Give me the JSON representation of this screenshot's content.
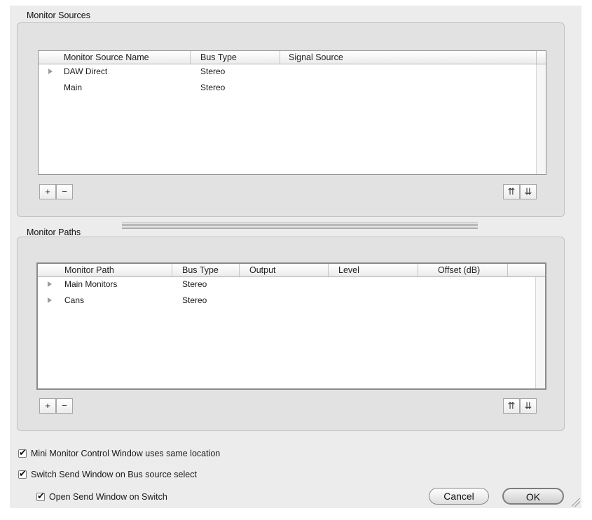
{
  "monitor_sources": {
    "title": "Monitor Sources",
    "columns": [
      "Monitor Source Name",
      "Bus Type",
      "Signal Source"
    ],
    "rows": [
      {
        "name": "DAW Direct",
        "bus_type": "Stereo",
        "signal_source": "",
        "expandable": true
      },
      {
        "name": "Main",
        "bus_type": "Stereo",
        "signal_source": "",
        "expandable": false
      }
    ],
    "buttons": {
      "add": "+",
      "remove": "−",
      "move_up": "⇈",
      "move_down": "⇊"
    }
  },
  "monitor_paths": {
    "title": "Monitor Paths",
    "columns": [
      "Monitor Path",
      "Bus Type",
      "Output",
      "Level",
      "Offset (dB)"
    ],
    "rows": [
      {
        "name": "Main Monitors",
        "bus_type": "Stereo",
        "output": "",
        "level": "",
        "offset": "",
        "expandable": true
      },
      {
        "name": "Cans",
        "bus_type": "Stereo",
        "output": "",
        "level": "",
        "offset": "",
        "expandable": true
      }
    ],
    "buttons": {
      "add": "+",
      "remove": "−",
      "move_up": "⇈",
      "move_down": "⇊"
    }
  },
  "options": [
    {
      "label": "Mini Monitor Control Window uses same location",
      "checked": true
    },
    {
      "label": "Switch Send Window on Bus source select",
      "checked": true
    },
    {
      "label": "Open Send Window on Switch",
      "checked": true
    }
  ],
  "footer": {
    "cancel_label": "Cancel",
    "ok_label": "OK"
  }
}
